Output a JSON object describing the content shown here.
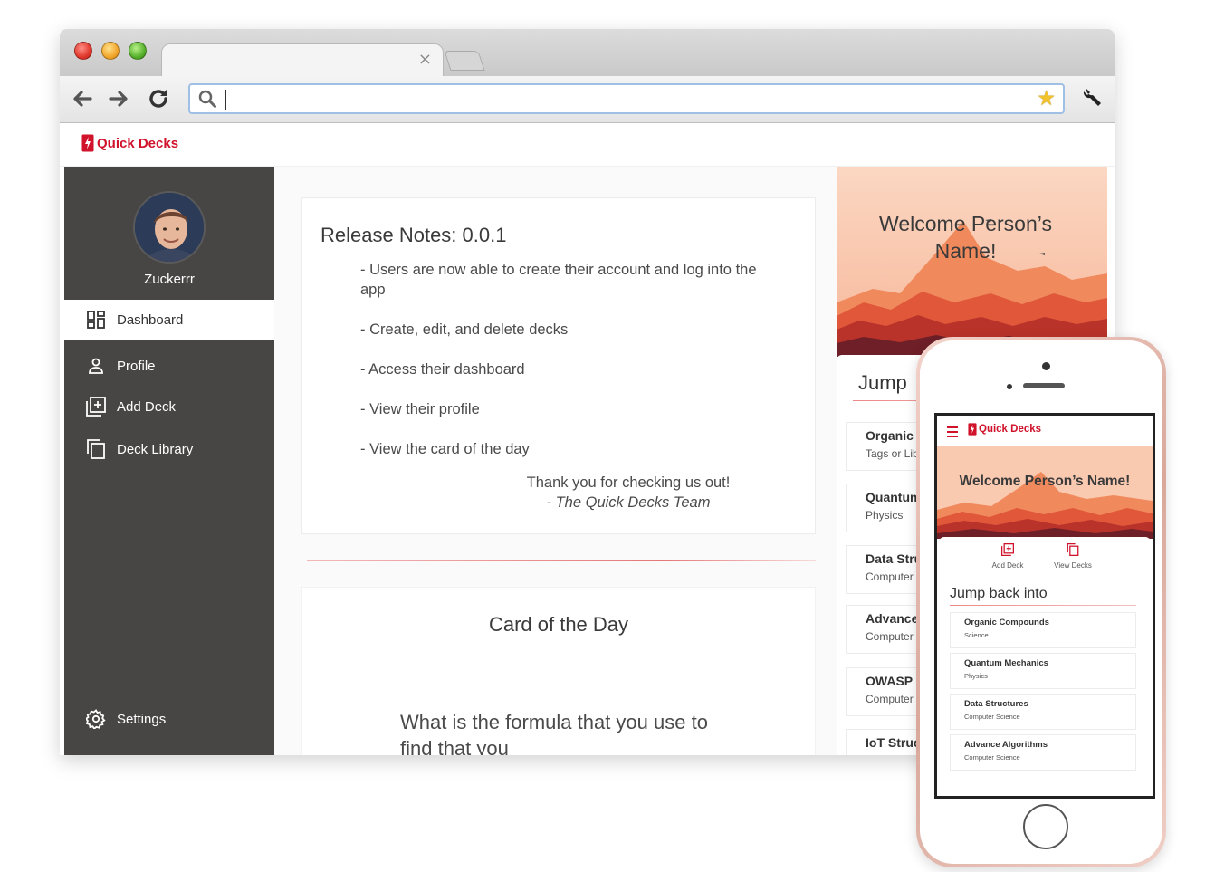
{
  "browser": {
    "address_value": "",
    "tab_close": "×"
  },
  "app": {
    "brand": "Quick Decks",
    "accent_color": "#d0122b",
    "sidebar_color": "#484545"
  },
  "sidebar": {
    "username": "Zuckerrr",
    "items": [
      {
        "label": "Dashboard",
        "icon": "dashboard-icon",
        "active": true
      },
      {
        "label": "Profile",
        "icon": "person-icon",
        "active": false
      },
      {
        "label": "Add Deck",
        "icon": "add-deck-icon",
        "active": false
      },
      {
        "label": "Deck Library",
        "icon": "deck-library-icon",
        "active": false
      }
    ],
    "settings_label": "Settings"
  },
  "release_notes": {
    "title": "Release Notes: 0.0.1",
    "items": [
      "- Users are now able to create their account and log into the app",
      "- Create, edit, and delete decks",
      "- Access their dashboard",
      "- View their profile",
      "- View the card of the day"
    ],
    "thanks": "Thank you for checking us out!",
    "signature": "- The Quick Decks Team"
  },
  "card_of_day": {
    "title": "Card of the Day",
    "question": "What is the formula that  you use to find that you"
  },
  "welcome": {
    "title": "Welcome Person’s Name!"
  },
  "jump": {
    "title": "Jump",
    "decks": [
      {
        "name": "Organic",
        "category": "Tags or Lib"
      },
      {
        "name": "Quantum",
        "category": "Physics"
      },
      {
        "name": "Data Stru",
        "category": "Computer"
      },
      {
        "name": "Advance",
        "category": "Computer"
      },
      {
        "name": "OWASP",
        "category": "Computer"
      },
      {
        "name": "IoT Struc",
        "category": ""
      }
    ]
  },
  "mobile": {
    "brand": "Quick Decks",
    "welcome": "Welcome Person’s Name!",
    "add_deck_label": "Add Deck",
    "view_decks_label": "View Decks",
    "jump_title": "Jump back into",
    "decks": [
      {
        "name": "Organic Compounds",
        "category": "Science"
      },
      {
        "name": "Quantum Mechanics",
        "category": "Physics"
      },
      {
        "name": "Data Structures",
        "category": "Computer Science"
      },
      {
        "name": "Advance Algorithms",
        "category": "Computer Science"
      }
    ]
  }
}
